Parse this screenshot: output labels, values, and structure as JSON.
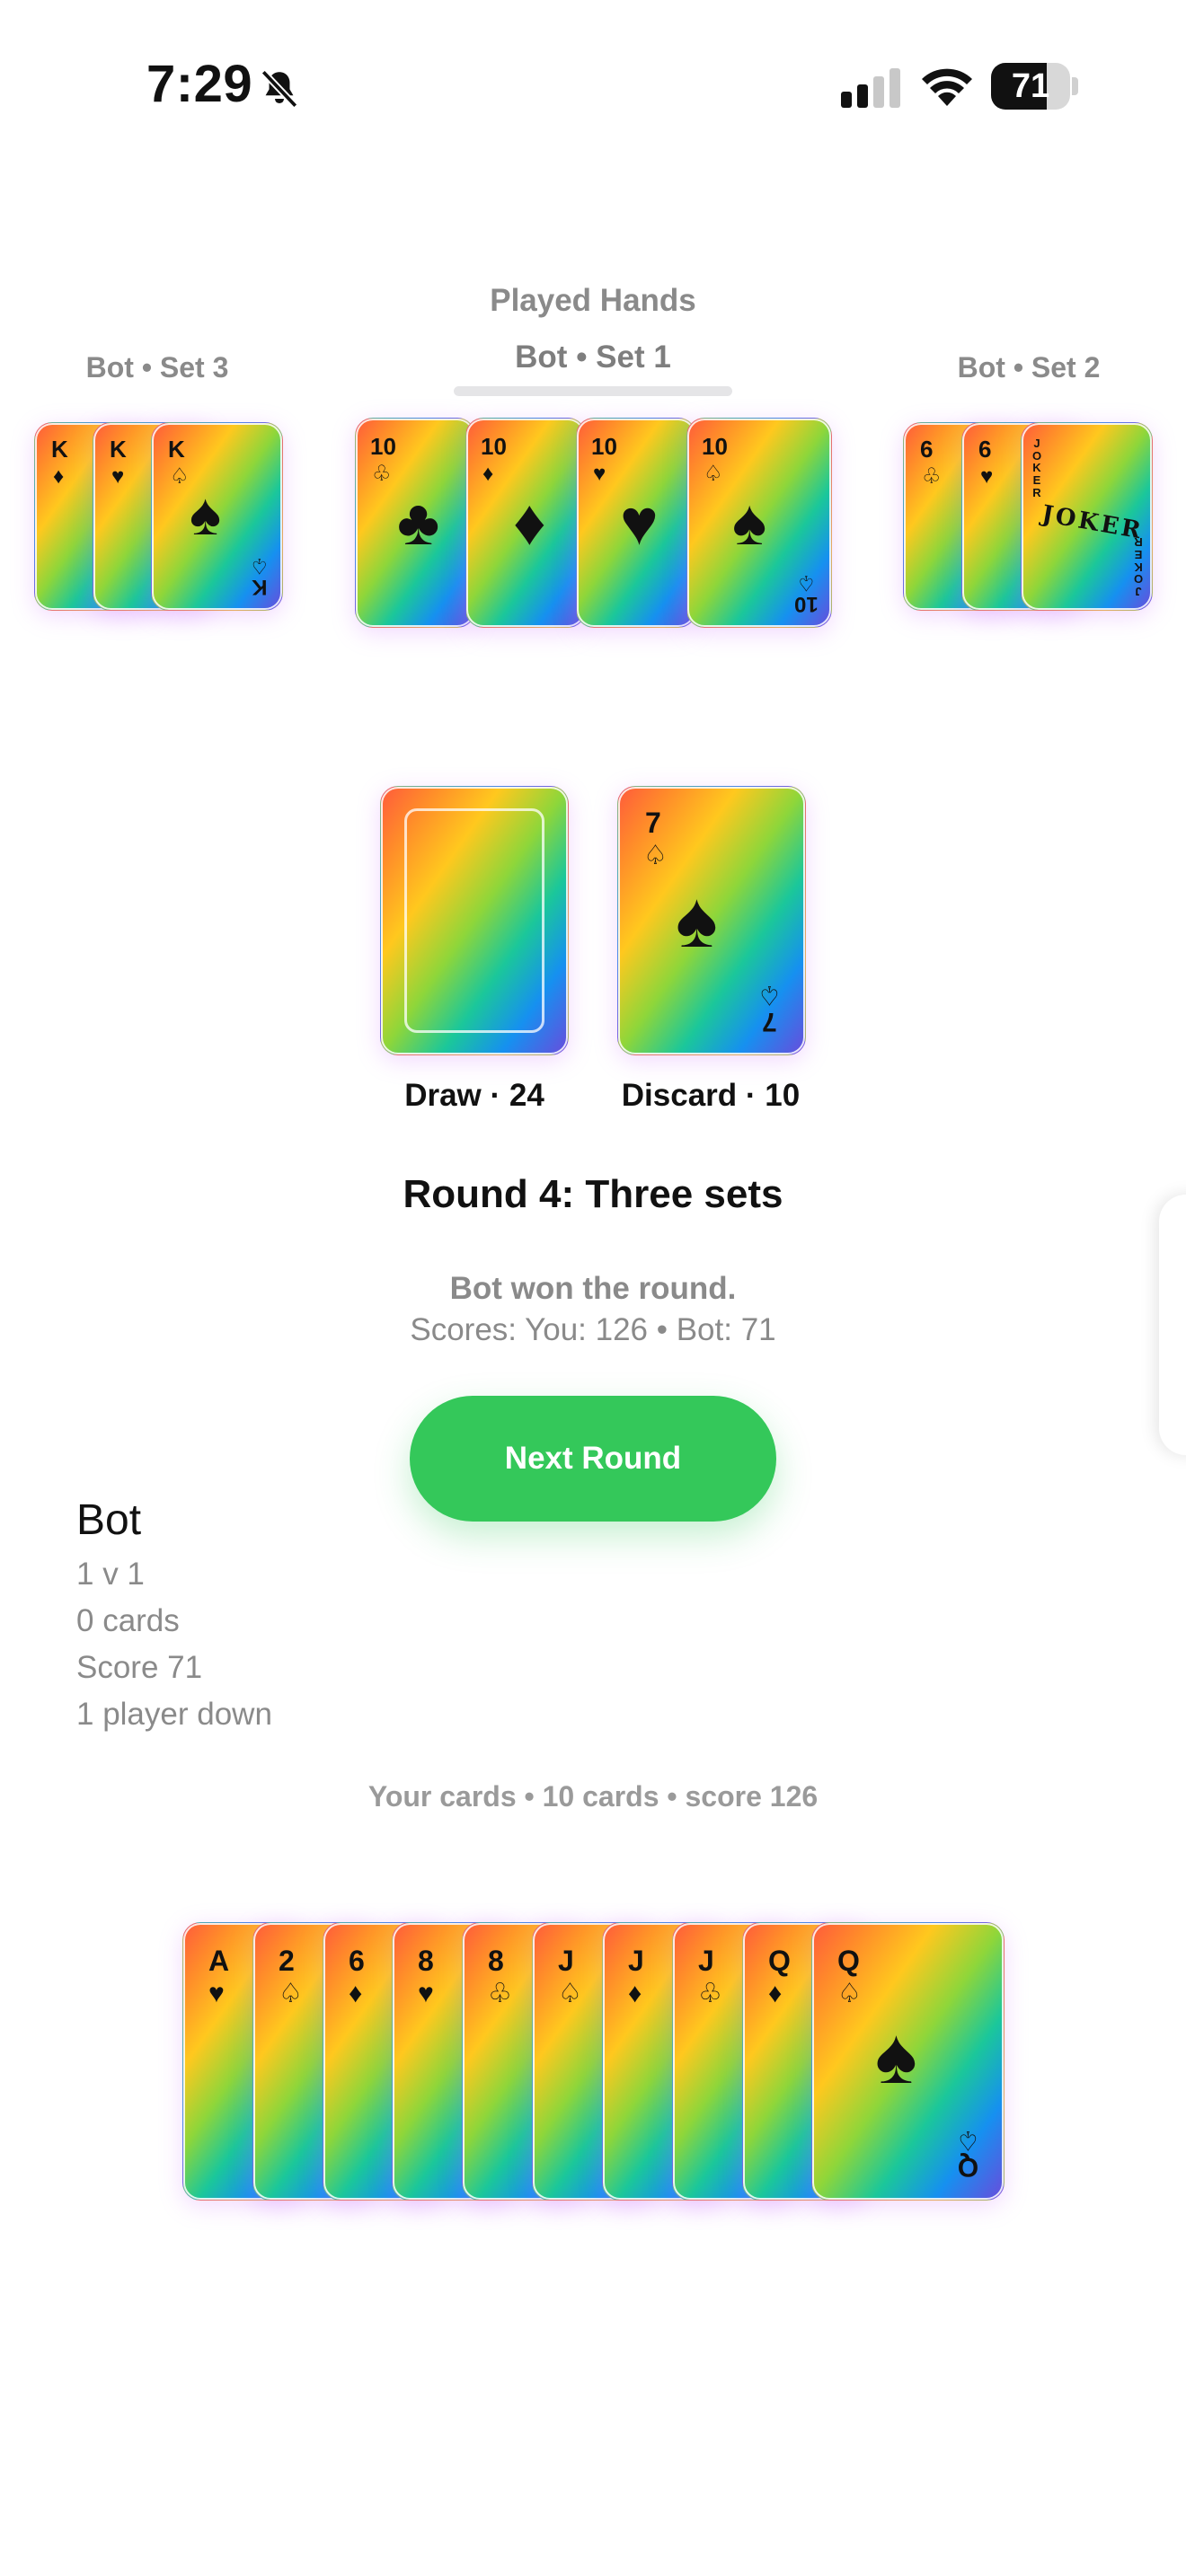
{
  "status_bar": {
    "time": "7:29",
    "battery": "71",
    "battery_level": 0.71
  },
  "played_hands": {
    "title": "Played Hands",
    "sets": [
      {
        "label": "Bot • Set 3",
        "cards": [
          {
            "rank": "K",
            "suit": "♦"
          },
          {
            "rank": "K",
            "suit": "♥"
          },
          {
            "rank": "K",
            "suit": "♤"
          }
        ]
      },
      {
        "label": "Bot • Set 1",
        "cards": [
          {
            "rank": "10",
            "suit": "♧"
          },
          {
            "rank": "10",
            "suit": "♦"
          },
          {
            "rank": "10",
            "suit": "♥"
          },
          {
            "rank": "10",
            "suit": "♤"
          }
        ]
      },
      {
        "label": "Bot • Set 2",
        "cards": [
          {
            "rank": "6",
            "suit": "♧"
          },
          {
            "rank": "6",
            "suit": "♥"
          },
          {
            "rank": "JOKER",
            "suit": ""
          }
        ]
      }
    ]
  },
  "piles": {
    "draw_label": "Draw · 24",
    "discard_label": "Discard · 10",
    "discard_card": {
      "rank": "7",
      "suit": "♤",
      "big_suit": "♠"
    }
  },
  "round": {
    "title": "Round 4: Three sets",
    "result": "Bot won the round.",
    "scores": "Scores: You: 126 • Bot: 71",
    "next_button": "Next Round"
  },
  "bot_panel": {
    "name": "Bot",
    "lines": [
      "1 v 1",
      "0 cards",
      "Score 71",
      "1 player down"
    ]
  },
  "hand": {
    "label": "Your cards • 10 cards • score 126",
    "cards": [
      {
        "rank": "A",
        "suit": "♥"
      },
      {
        "rank": "2",
        "suit": "♤"
      },
      {
        "rank": "6",
        "suit": "♦"
      },
      {
        "rank": "8",
        "suit": "♥"
      },
      {
        "rank": "8",
        "suit": "♧"
      },
      {
        "rank": "J",
        "suit": "♤"
      },
      {
        "rank": "J",
        "suit": "♦"
      },
      {
        "rank": "J",
        "suit": "♧"
      },
      {
        "rank": "Q",
        "suit": "♦"
      },
      {
        "rank": "Q",
        "suit": "♤"
      }
    ]
  }
}
